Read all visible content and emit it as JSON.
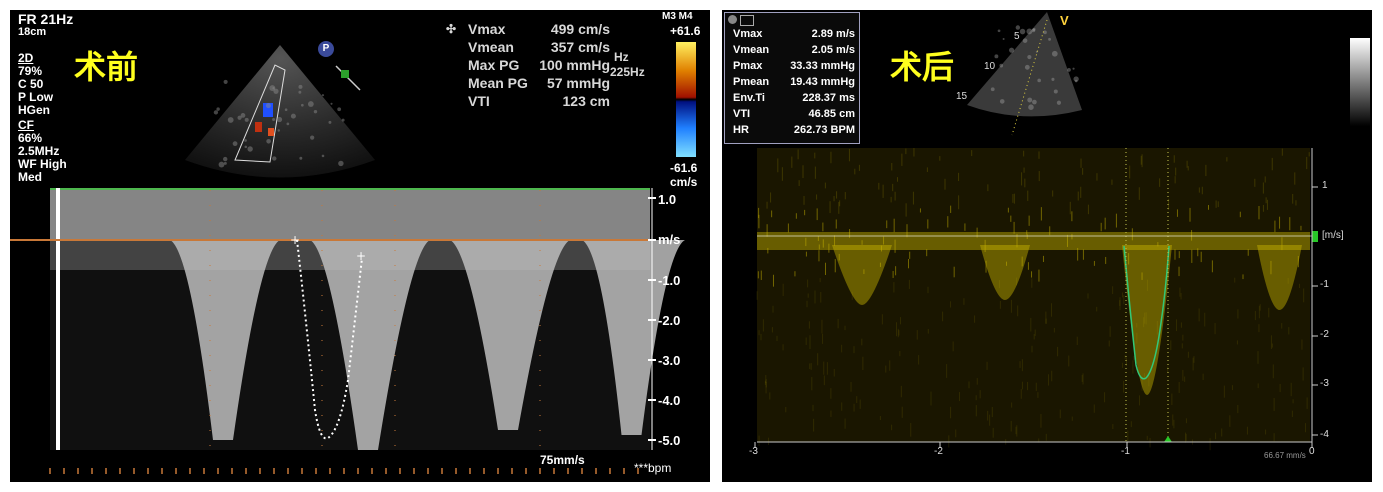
{
  "left_panel": {
    "label": "术前",
    "frame_rate": "FR 21Hz",
    "depth": "18cm",
    "settings": [
      "2D",
      "79%",
      "C 50",
      "P Low",
      "HGen",
      "CF",
      "66%",
      "2.5MHz",
      "WF High",
      "Med"
    ],
    "probe_mode": "M3 M4",
    "color_scale": {
      "top": "+61.6",
      "bottom": "-61.6",
      "unit": "cm/s"
    },
    "hz_labels": [
      "Hz",
      "225Hz"
    ],
    "marker": "P",
    "measurements": [
      {
        "label": "Vmax",
        "value": "499 cm/s"
      },
      {
        "label": "Vmean",
        "value": "357 cm/s"
      },
      {
        "label": "Max PG",
        "value": "100 mmHg"
      },
      {
        "label": "Mean PG",
        "value": "57 mmHg"
      },
      {
        "label": "VTI",
        "value": "123 cm"
      }
    ],
    "axis": {
      "unit": "m/s",
      "ticks": [
        "1.0",
        "-1.0",
        "-2.0",
        "-3.0",
        "-4.0",
        "-5.0"
      ]
    },
    "sweep_speed": "75mm/s",
    "hr_label": "***bpm",
    "colors": {
      "baseline": "#c87838",
      "trace": "#ffffff",
      "top_line": "#3cc83c"
    }
  },
  "right_panel": {
    "label": "术后",
    "measurements": [
      {
        "label": "Vmax",
        "value": "2.89 m/s"
      },
      {
        "label": "Vmean",
        "value": "2.05 m/s"
      },
      {
        "label": "Pmax",
        "value": "33.33 mmHg"
      },
      {
        "label": "Pmean",
        "value": "19.43 mmHg"
      },
      {
        "label": "Env.Ti",
        "value": "228.37 ms"
      },
      {
        "label": "VTI",
        "value": "46.85 cm"
      },
      {
        "label": "HR",
        "value": "262.73 BPM"
      }
    ],
    "sector_label": "V",
    "depth_labels": [
      "5",
      "10",
      "15"
    ],
    "axis": {
      "unit": "[m/s]",
      "y_ticks": [
        "1",
        "-1",
        "-2",
        "-3",
        "-4"
      ],
      "x_ticks": [
        "-3",
        "-2",
        "-1",
        "0"
      ]
    },
    "sweep_speed": "66.67 mm/s",
    "colors": {
      "doppler": "#c8b400",
      "trace": "#32c878",
      "marker": "#28c828"
    }
  }
}
